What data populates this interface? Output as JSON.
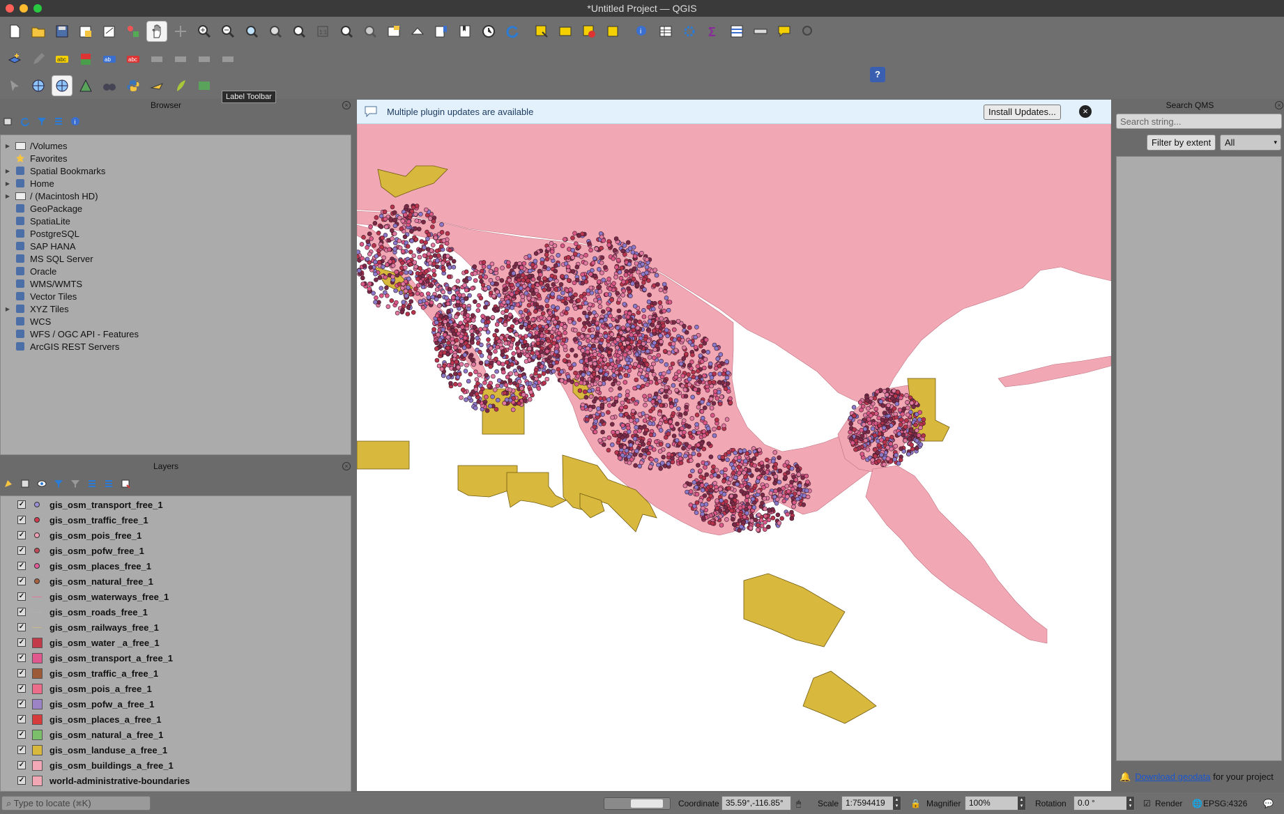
{
  "window": {
    "title": "*Untitled Project — QGIS"
  },
  "toolbar": {
    "tooltip": "Label Toolbar",
    "help_label": "?"
  },
  "browser": {
    "title": "Browser",
    "items": [
      {
        "label": "/Volumes",
        "icon": "folder-icon",
        "expandable": true
      },
      {
        "label": "Favorites",
        "icon": "star-icon",
        "expandable": false
      },
      {
        "label": "Spatial Bookmarks",
        "icon": "bookmark-icon",
        "expandable": true
      },
      {
        "label": "Home",
        "icon": "home-icon",
        "expandable": true
      },
      {
        "label": "/ (Macintosh HD)",
        "icon": "folder-icon",
        "expandable": true
      },
      {
        "label": "GeoPackage",
        "icon": "geopackage-icon",
        "expandable": false
      },
      {
        "label": "SpatiaLite",
        "icon": "spatialite-icon",
        "expandable": false
      },
      {
        "label": "PostgreSQL",
        "icon": "postgresql-icon",
        "expandable": false
      },
      {
        "label": "SAP HANA",
        "icon": "sap-hana-icon",
        "expandable": false
      },
      {
        "label": "MS SQL Server",
        "icon": "mssql-icon",
        "expandable": false
      },
      {
        "label": "Oracle",
        "icon": "oracle-icon",
        "expandable": false
      },
      {
        "label": "WMS/WMTS",
        "icon": "wms-icon",
        "expandable": false
      },
      {
        "label": "Vector Tiles",
        "icon": "vector-tiles-icon",
        "expandable": false
      },
      {
        "label": "XYZ Tiles",
        "icon": "xyz-tiles-icon",
        "expandable": true
      },
      {
        "label": "WCS",
        "icon": "wcs-icon",
        "expandable": false
      },
      {
        "label": "WFS / OGC API - Features",
        "icon": "wfs-icon",
        "expandable": false
      },
      {
        "label": "ArcGIS REST Servers",
        "icon": "arcgis-icon",
        "expandable": false
      }
    ]
  },
  "layers": {
    "title": "Layers",
    "items": [
      {
        "name": "gis_osm_transport_free_1",
        "kind": "point",
        "color": "#9b8fd6",
        "checked": true
      },
      {
        "name": "gis_osm_traffic_free_1",
        "kind": "point",
        "color": "#d0394e",
        "checked": true
      },
      {
        "name": "gis_osm_pois_free_1",
        "kind": "point",
        "color": "#f2a0b4",
        "checked": true
      },
      {
        "name": "gis_osm_pofw_free_1",
        "kind": "point",
        "color": "#c04a58",
        "checked": true
      },
      {
        "name": "gis_osm_places_free_1",
        "kind": "point",
        "color": "#e45b9a",
        "checked": true
      },
      {
        "name": "gis_osm_natural_free_1",
        "kind": "point",
        "color": "#a9603f",
        "checked": true
      },
      {
        "name": "gis_osm_waterways_free_1",
        "kind": "line",
        "color": "#e07a9a",
        "checked": true
      },
      {
        "name": "gis_osm_roads_free_1",
        "kind": "line",
        "color": "#b0b0b0",
        "checked": true
      },
      {
        "name": "gis_osm_railways_free_1",
        "kind": "line",
        "color": "#c9b88a",
        "checked": true
      },
      {
        "name": "gis_osm_water _a_free_1",
        "kind": "polygon",
        "color": "#c23a4a",
        "checked": true
      },
      {
        "name": "gis_osm_transport_a_free_1",
        "kind": "polygon",
        "color": "#e0588e",
        "checked": true
      },
      {
        "name": "gis_osm_traffic_a_free_1",
        "kind": "polygon",
        "color": "#9c5a36",
        "checked": true
      },
      {
        "name": "gis_osm_pois_a_free_1",
        "kind": "polygon",
        "color": "#ec6d8a",
        "checked": true
      },
      {
        "name": "gis_osm_pofw_a_free_1",
        "kind": "polygon",
        "color": "#9b83c6",
        "checked": true
      },
      {
        "name": "gis_osm_places_a_free_1",
        "kind": "polygon",
        "color": "#d63c3c",
        "checked": true
      },
      {
        "name": "gis_osm_natural_a_free_1",
        "kind": "polygon",
        "color": "#7cbf6a",
        "checked": true
      },
      {
        "name": "gis_osm_landuse_a_free_1",
        "kind": "polygon",
        "color": "#d9b83e",
        "checked": true
      },
      {
        "name": "gis_osm_buildings_a_free_1",
        "kind": "polygon",
        "color": "#f3a8b8",
        "checked": true
      },
      {
        "name": "world-administrative-boundaries",
        "kind": "polygon",
        "color": "#f2a8b4",
        "checked": true
      }
    ]
  },
  "message": {
    "text": "Multiple plugin updates are available",
    "button": "Install Updates..."
  },
  "qms": {
    "title": "Search QMS",
    "placeholder": "Search string...",
    "filter_button": "Filter by extent",
    "select_value": "All",
    "footer_link": "Download geodata",
    "footer_text": " for your project"
  },
  "statusbar": {
    "locator_placeholder": "Type to locate (⌘K)",
    "coordinate_label": "Coordinate",
    "coordinate_value": "35.59°,-116.85°",
    "scale_label": "Scale",
    "scale_value": "1:7594419",
    "magnifier_label": "Magnifier",
    "magnifier_value": "100%",
    "rotation_label": "Rotation",
    "rotation_value": "0.0 °",
    "render_label": "Render",
    "crs_label": "EPSG:4326"
  },
  "colors": {
    "land": "#f2a8b4",
    "landuse": "#d9b83e",
    "points_red": "#b8334c",
    "points_purple": "#8a78c8",
    "sea": "#ffffff"
  }
}
